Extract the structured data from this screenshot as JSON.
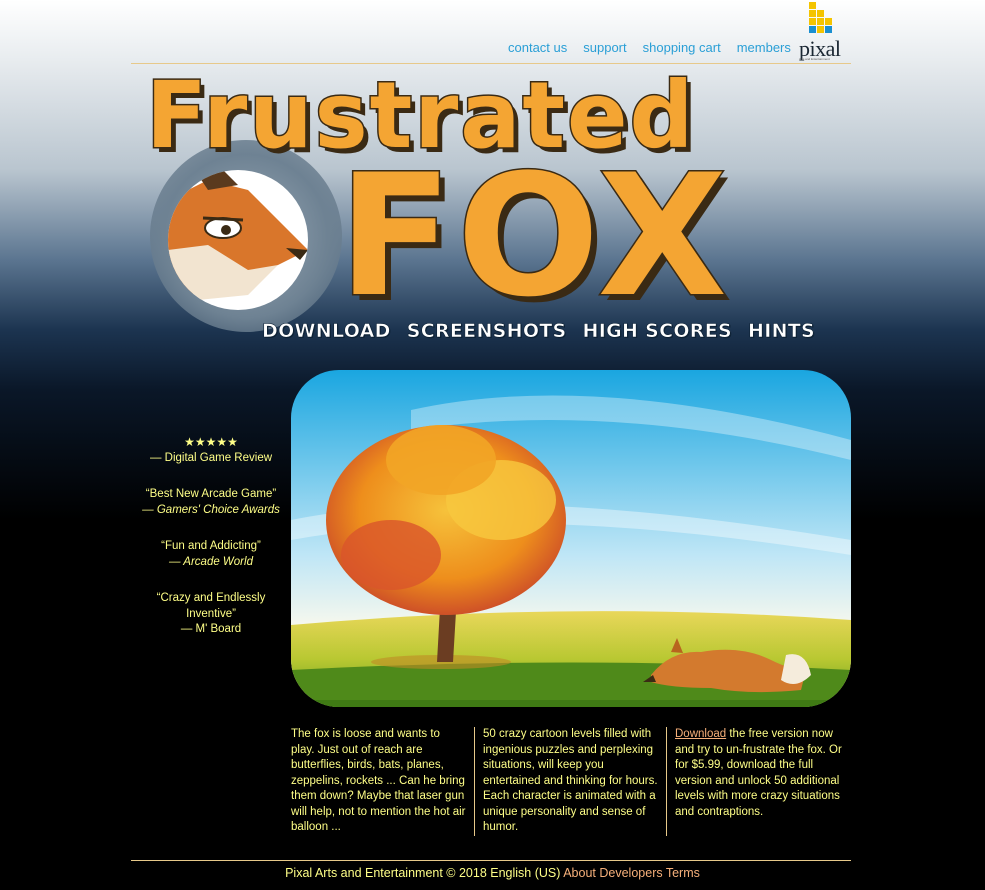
{
  "top_nav": [
    {
      "label": "contact us"
    },
    {
      "label": "support"
    },
    {
      "label": "shopping cart"
    },
    {
      "label": "members"
    }
  ],
  "logo": {
    "text": "pixal",
    "subtext": "Arts and Entertainment"
  },
  "banner": {
    "title_line1": "Frustrated",
    "title_line2": "FOX"
  },
  "main_nav": [
    {
      "label": "DOWNLOAD"
    },
    {
      "label": "SCREENSHOTS"
    },
    {
      "label": "HIGH SCORES"
    },
    {
      "label": "HINTS"
    }
  ],
  "reviews": [
    {
      "quote": "★★★★★",
      "source": "— Digital Game Review",
      "italic": false
    },
    {
      "quote": "“Best New Arcade Game”",
      "source": "— Gamers' Choice Awards",
      "italic": true
    },
    {
      "quote": "“Fun and Addicting”",
      "source": "— Arcade World",
      "italic": true
    },
    {
      "quote": "“Crazy and Endlessly Inventive”",
      "source": "— M' Board",
      "italic": false
    }
  ],
  "columns": {
    "col1": "The fox is loose and wants to play. Just out of reach are butterflies, birds, bats, planes, zeppelins, rockets ... Can he bring them down? Maybe that laser gun will help, not to mention the hot air balloon ...",
    "col2": "50 crazy cartoon levels filled with ingenious puzzles and perplexing situations, will keep you entertained and thinking for hours. Each character is animated with a unique personality and sense of humor.",
    "col3_link": "Download",
    "col3_text": " the free version now and try to un-frustrate the fox. Or for $5.99, download the full version and unlock 50 additional levels with more crazy situations and contraptions."
  },
  "footer": {
    "text": "Pixal Arts and Entertainment © 2018 English (US)",
    "links": [
      "About",
      "Developers",
      "Terms"
    ]
  },
  "colors": {
    "accent_link": "#2a9fd6",
    "title_orange": "#f4a533",
    "body_text": "#ffff88",
    "footer_link": "#f6b07a"
  }
}
